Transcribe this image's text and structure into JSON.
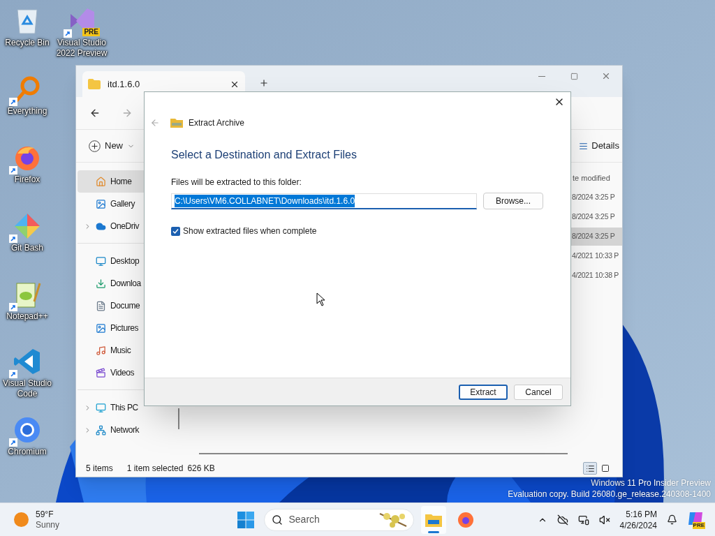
{
  "desktop_icons": [
    {
      "kind": "recycle",
      "label": "Recycle Bin",
      "shortcut": false
    },
    {
      "kind": "vs-preview",
      "label": "Visual Studio 2022 Preview",
      "badge": "PRE",
      "shortcut": true
    },
    {
      "kind": "everything",
      "label": "Everything",
      "shortcut": true
    },
    {
      "kind": "firefox",
      "label": "Firefox",
      "shortcut": true
    },
    {
      "kind": "git",
      "label": "Git Bash",
      "shortcut": true
    },
    {
      "kind": "notepad",
      "label": "Notepad++",
      "shortcut": true
    },
    {
      "kind": "vscode",
      "label": "Visual Studio Code",
      "shortcut": true
    },
    {
      "kind": "chromium",
      "label": "Chromium",
      "shortcut": true
    }
  ],
  "explorer": {
    "tab": {
      "title": "itd.1.6.0"
    },
    "command_bar": {
      "new": "New",
      "details": "Details"
    },
    "sidebar": {
      "groups": [
        {
          "items": [
            {
              "label": "Home",
              "expandable": false,
              "selected": true
            },
            {
              "label": "Gallery",
              "expandable": false,
              "selected": false
            },
            {
              "label": "OneDriv",
              "expandable": true,
              "selected": false
            }
          ]
        },
        {
          "items": [
            {
              "label": "Desktop",
              "expandable": false,
              "selected": false
            },
            {
              "label": "Downloa",
              "expandable": false,
              "selected": false
            },
            {
              "label": "Docume",
              "expandable": false,
              "selected": false
            },
            {
              "label": "Pictures",
              "expandable": false,
              "selected": false
            },
            {
              "label": "Music",
              "expandable": false,
              "selected": false
            },
            {
              "label": "Videos",
              "expandable": false,
              "selected": false
            }
          ]
        },
        {
          "items": [
            {
              "label": "This PC",
              "expandable": true,
              "selected": false
            },
            {
              "label": "Network",
              "expandable": true,
              "selected": false
            }
          ]
        }
      ]
    },
    "column_header": "te modified",
    "rows": [
      {
        "date": "8/2024 3:25 P",
        "selected": false
      },
      {
        "date": "8/2024 3:25 P",
        "selected": false
      },
      {
        "date": "8/2024 3:25 P",
        "selected": true
      },
      {
        "date": "4/2021 10:33 P",
        "selected": false
      },
      {
        "date": "4/2021 10:38 P",
        "selected": false
      }
    ],
    "status_bar": {
      "item_count": "5 items",
      "selection": "1 item selected",
      "size": "626 KB",
      "views": [
        {
          "kind": "details",
          "selected": true
        },
        {
          "kind": "tiles",
          "selected": false
        }
      ]
    }
  },
  "dialog": {
    "title": "Extract Archive",
    "heading": "Select a Destination and Extract Files",
    "label": "Files will be extracted to this folder:",
    "path": {
      "value": "C:\\Users\\VM6.COLLABNET\\Downloads\\itd.1.6.0",
      "selected": true
    },
    "browse": "Browse...",
    "checkbox": {
      "label": "Show extracted files when complete",
      "checked": true
    },
    "buttons": [
      {
        "label": "Extract",
        "default": true
      },
      {
        "label": "Cancel",
        "default": false
      }
    ]
  },
  "os_notice": {
    "line_1": "Windows 11 Pro Insider Preview",
    "line_2": "Evaluation copy. Build 26080.ge_release.240308-1400"
  },
  "taskbar": {
    "weather": {
      "temperature": "59°F",
      "condition": "Sunny"
    },
    "search": {
      "placeholder": "Search"
    },
    "apps": [
      {
        "kind": "explorer",
        "selected": true
      },
      {
        "kind": "firefox",
        "selected": false
      }
    ],
    "time": "5:16 PM",
    "date": "4/26/2024",
    "copilot_badge": "PRE"
  }
}
